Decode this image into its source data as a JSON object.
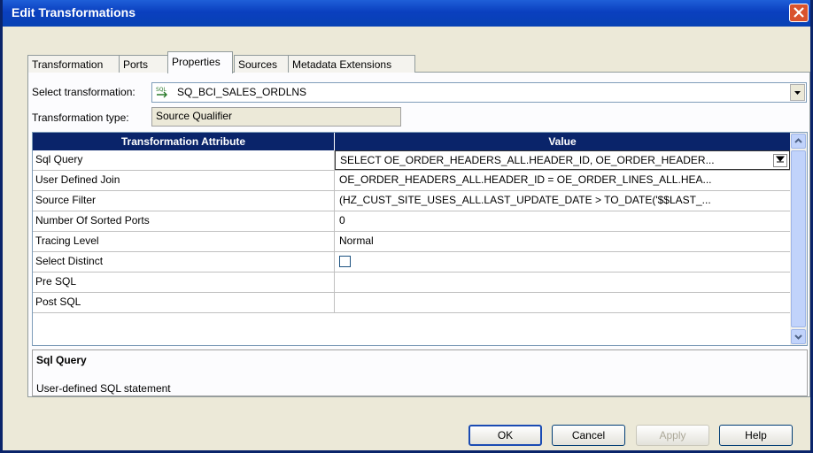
{
  "window": {
    "title": "Edit Transformations"
  },
  "tabs": [
    {
      "label": "Transformation"
    },
    {
      "label": "Ports"
    },
    {
      "label": "Properties"
    },
    {
      "label": "Sources"
    },
    {
      "label": "Metadata Extensions"
    }
  ],
  "active_tab": "Properties",
  "select_transformation": {
    "label": "Select transformation:",
    "icon": "sql-source-qualifier-icon",
    "icon_text": "SQL",
    "value": "SQ_BCI_SALES_ORDLNS"
  },
  "transformation_type": {
    "label": "Transformation type:",
    "value": "Source Qualifier"
  },
  "grid": {
    "headers": {
      "attribute": "Transformation Attribute",
      "value": "Value"
    },
    "rows": [
      {
        "attribute": "Sql Query",
        "value": "SELECT OE_ORDER_HEADERS_ALL.HEADER_ID, OE_ORDER_HEADER..."
      },
      {
        "attribute": "User Defined Join",
        "value": "OE_ORDER_HEADERS_ALL.HEADER_ID = OE_ORDER_LINES_ALL.HEA..."
      },
      {
        "attribute": "Source Filter",
        "value": "(HZ_CUST_SITE_USES_ALL.LAST_UPDATE_DATE > TO_DATE('$$LAST_..."
      },
      {
        "attribute": "Number Of Sorted Ports",
        "value": "0"
      },
      {
        "attribute": "Tracing Level",
        "value": "Normal"
      },
      {
        "attribute": "Select Distinct",
        "value": ""
      },
      {
        "attribute": "Pre SQL",
        "value": ""
      },
      {
        "attribute": "Post SQL",
        "value": ""
      }
    ]
  },
  "description": {
    "title": "Sql Query",
    "text": "User-defined SQL statement"
  },
  "buttons": {
    "ok": "OK",
    "cancel": "Cancel",
    "apply": "Apply",
    "help": "Help"
  }
}
